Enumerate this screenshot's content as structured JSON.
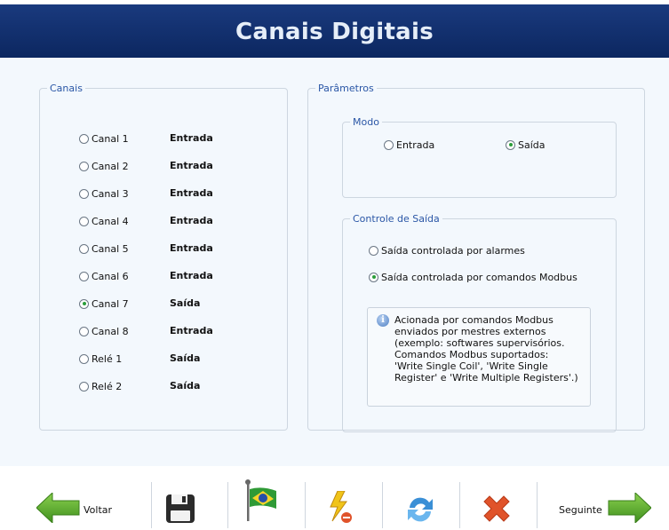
{
  "header": {
    "title": "Canais Digitais"
  },
  "canais": {
    "legend": "Canais",
    "items": [
      {
        "label": "Canal 1",
        "mode": "Entrada",
        "selected": false
      },
      {
        "label": "Canal 2",
        "mode": "Entrada",
        "selected": false
      },
      {
        "label": "Canal 3",
        "mode": "Entrada",
        "selected": false
      },
      {
        "label": "Canal 4",
        "mode": "Entrada",
        "selected": false
      },
      {
        "label": "Canal 5",
        "mode": "Entrada",
        "selected": false
      },
      {
        "label": "Canal 6",
        "mode": "Entrada",
        "selected": false
      },
      {
        "label": "Canal 7",
        "mode": "Saída",
        "selected": true
      },
      {
        "label": "Canal 8",
        "mode": "Entrada",
        "selected": false
      },
      {
        "label": "Relé 1",
        "mode": "Saída",
        "selected": false
      },
      {
        "label": "Relé 2",
        "mode": "Saída",
        "selected": false
      }
    ]
  },
  "parametros": {
    "legend": "Parâmetros",
    "modo": {
      "legend": "Modo",
      "options": [
        {
          "label": "Entrada",
          "selected": false
        },
        {
          "label": "Saída",
          "selected": true
        }
      ]
    },
    "controle": {
      "legend": "Controle de Saída",
      "options": [
        {
          "label": "Saída controlada por alarmes",
          "selected": false
        },
        {
          "label": "Saída controlada por comandos Modbus",
          "selected": true
        }
      ],
      "info_lines": [
        "Acionada por comandos Modbus",
        "enviados por mestres externos",
        "(exemplo: softwares supervisórios.",
        "Comandos Modbus suportados:",
        "'Write Single Coil', 'Write Single",
        "Register' e 'Write Multiple Registers'.)"
      ]
    }
  },
  "toolbar": {
    "back_label": "Voltar",
    "next_label": "Seguinte",
    "icons": [
      "arrow-left-icon",
      "floppy-disk-icon",
      "brazil-flag-icon",
      "lightning-icon",
      "refresh-icon",
      "close-x-icon",
      "arrow-right-icon"
    ],
    "colors": {
      "green": "#5aa82a",
      "red": "#e0532a",
      "blue": "#3a8fd6",
      "header": "#0e2d6b"
    }
  }
}
